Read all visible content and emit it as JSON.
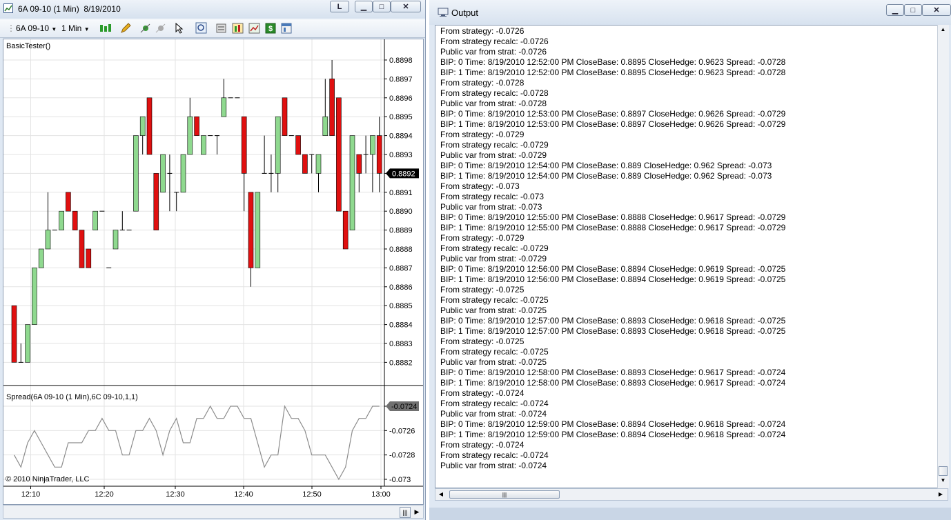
{
  "chart_window": {
    "title": "6A 09-10 (1 Min)  8/19/2010",
    "btn_l": "L",
    "toolbar": {
      "instrument": "6A 09-10",
      "interval": "1 Min"
    },
    "strategy_label": "BasicTester()",
    "indicator_label": "Spread(6A 09-10 (1 Min),6C 09-10,1,1)",
    "copyright": "© 2010 NinjaTrader, LLC",
    "price_current": "0.8892",
    "spread_current": "-0.0724"
  },
  "chart_data": [
    {
      "type": "candlestick",
      "title": "6A 09-10 (1 Min)",
      "ylim": [
        0.8881,
        0.8899
      ],
      "y_ticks": [
        "0.8898",
        "0.8897",
        "0.8896",
        "0.8895",
        "0.8894",
        "0.8893",
        "0.8892",
        "0.8891",
        "0.8890",
        "0.8889",
        "0.8888",
        "0.8887",
        "0.8886",
        "0.8885",
        "0.8884",
        "0.8883",
        "0.8882"
      ],
      "x_ticks": [
        "12:10",
        "12:20",
        "12:30",
        "12:40",
        "12:50",
        "13:00"
      ],
      "bars": [
        {
          "o": 0.8885,
          "h": 0.8885,
          "l": 0.8882,
          "c": 0.8882
        },
        {
          "o": 0.8882,
          "h": 0.8883,
          "l": 0.8882,
          "c": 0.8882
        },
        {
          "o": 0.8882,
          "h": 0.8884,
          "l": 0.8882,
          "c": 0.8884
        },
        {
          "o": 0.8884,
          "h": 0.8887,
          "l": 0.8884,
          "c": 0.8887
        },
        {
          "o": 0.8887,
          "h": 0.8888,
          "l": 0.8887,
          "c": 0.8888
        },
        {
          "o": 0.8888,
          "h": 0.8891,
          "l": 0.8888,
          "c": 0.8889
        },
        {
          "o": 0.8889,
          "h": 0.8889,
          "l": 0.8889,
          "c": 0.8889
        },
        {
          "o": 0.8889,
          "h": 0.889,
          "l": 0.8889,
          "c": 0.889
        },
        {
          "o": 0.8891,
          "h": 0.8891,
          "l": 0.889,
          "c": 0.889
        },
        {
          "o": 0.889,
          "h": 0.889,
          "l": 0.8889,
          "c": 0.8889
        },
        {
          "o": 0.8889,
          "h": 0.8889,
          "l": 0.8887,
          "c": 0.8887
        },
        {
          "o": 0.8888,
          "h": 0.8888,
          "l": 0.8887,
          "c": 0.8887
        },
        {
          "o": 0.8889,
          "h": 0.889,
          "l": 0.8889,
          "c": 0.889
        },
        {
          "o": 0.889,
          "h": 0.889,
          "l": 0.889,
          "c": 0.889
        },
        {
          "o": 0.8887,
          "h": 0.8887,
          "l": 0.8887,
          "c": 0.8887
        },
        {
          "o": 0.8888,
          "h": 0.8889,
          "l": 0.8888,
          "c": 0.8889
        },
        {
          "o": 0.8889,
          "h": 0.889,
          "l": 0.8889,
          "c": 0.8889
        },
        {
          "o": 0.8889,
          "h": 0.8889,
          "l": 0.8889,
          "c": 0.8889
        },
        {
          "o": 0.889,
          "h": 0.8894,
          "l": 0.889,
          "c": 0.8894
        },
        {
          "o": 0.8894,
          "h": 0.8895,
          "l": 0.8893,
          "c": 0.8895
        },
        {
          "o": 0.8896,
          "h": 0.8896,
          "l": 0.8893,
          "c": 0.8893
        },
        {
          "o": 0.8892,
          "h": 0.8892,
          "l": 0.8889,
          "c": 0.8889
        },
        {
          "o": 0.8891,
          "h": 0.8893,
          "l": 0.8891,
          "c": 0.8893
        },
        {
          "o": 0.8892,
          "h": 0.8893,
          "l": 0.889,
          "c": 0.8892
        },
        {
          "o": 0.8891,
          "h": 0.8891,
          "l": 0.889,
          "c": 0.8891
        },
        {
          "o": 0.8891,
          "h": 0.8893,
          "l": 0.8891,
          "c": 0.8893
        },
        {
          "o": 0.8893,
          "h": 0.8896,
          "l": 0.8893,
          "c": 0.8895
        },
        {
          "o": 0.8895,
          "h": 0.8895,
          "l": 0.8894,
          "c": 0.8894
        },
        {
          "o": 0.8893,
          "h": 0.8894,
          "l": 0.8893,
          "c": 0.8894
        },
        {
          "o": 0.8894,
          "h": 0.8894,
          "l": 0.8894,
          "c": 0.8894
        },
        {
          "o": 0.8894,
          "h": 0.8894,
          "l": 0.8893,
          "c": 0.8894
        },
        {
          "o": 0.8895,
          "h": 0.8897,
          "l": 0.8895,
          "c": 0.8896
        },
        {
          "o": 0.8896,
          "h": 0.8896,
          "l": 0.8896,
          "c": 0.8896
        },
        {
          "o": 0.8896,
          "h": 0.8896,
          "l": 0.8896,
          "c": 0.8896
        },
        {
          "o": 0.8895,
          "h": 0.8895,
          "l": 0.889,
          "c": 0.8892
        },
        {
          "o": 0.8891,
          "h": 0.8891,
          "l": 0.8886,
          "c": 0.8887
        },
        {
          "o": 0.8887,
          "h": 0.8891,
          "l": 0.8887,
          "c": 0.8891
        },
        {
          "o": 0.8892,
          "h": 0.8894,
          "l": 0.8892,
          "c": 0.8892
        },
        {
          "o": 0.8892,
          "h": 0.8893,
          "l": 0.8891,
          "c": 0.8892
        },
        {
          "o": 0.8892,
          "h": 0.8895,
          "l": 0.8891,
          "c": 0.8895
        },
        {
          "o": 0.8896,
          "h": 0.8896,
          "l": 0.8894,
          "c": 0.8894
        },
        {
          "o": 0.8894,
          "h": 0.8894,
          "l": 0.8894,
          "c": 0.8894
        },
        {
          "o": 0.8894,
          "h": 0.8894,
          "l": 0.8893,
          "c": 0.8893
        },
        {
          "o": 0.8893,
          "h": 0.8893,
          "l": 0.8892,
          "c": 0.8892
        },
        {
          "o": 0.8893,
          "h": 0.8893,
          "l": 0.8892,
          "c": 0.8893
        },
        {
          "o": 0.8892,
          "h": 0.8893,
          "l": 0.8891,
          "c": 0.8893
        },
        {
          "o": 0.8894,
          "h": 0.8897,
          "l": 0.8894,
          "c": 0.8895
        },
        {
          "o": 0.8897,
          "h": 0.8898,
          "l": 0.8894,
          "c": 0.8894
        },
        {
          "o": 0.8896,
          "h": 0.8896,
          "l": 0.889,
          "c": 0.889
        },
        {
          "o": 0.889,
          "h": 0.889,
          "l": 0.8888,
          "c": 0.8888
        },
        {
          "o": 0.8889,
          "h": 0.8894,
          "l": 0.8889,
          "c": 0.8894
        },
        {
          "o": 0.8893,
          "h": 0.8893,
          "l": 0.8891,
          "c": 0.8892
        },
        {
          "o": 0.8893,
          "h": 0.8894,
          "l": 0.8892,
          "c": 0.8893
        },
        {
          "o": 0.8893,
          "h": 0.8894,
          "l": 0.8891,
          "c": 0.8894
        },
        {
          "o": 0.8894,
          "h": 0.8895,
          "l": 0.8891,
          "c": 0.8892
        }
      ]
    },
    {
      "type": "line",
      "title": "Spread(6A 09-10 (1 Min),6C 09-10,1,1)",
      "ylim": [
        -0.07305,
        -0.07235
      ],
      "y_ticks": [
        "-0.0724",
        "-0.0726",
        "-0.0728",
        "-0.073"
      ],
      "series": [
        {
          "values": [
            -0.0728,
            -0.0729,
            -0.0727,
            -0.0726,
            -0.0727,
            -0.0728,
            -0.0729,
            -0.0729,
            -0.0727,
            -0.0727,
            -0.0727,
            -0.0726,
            -0.0726,
            -0.0725,
            -0.0726,
            -0.0726,
            -0.0728,
            -0.0728,
            -0.0726,
            -0.0726,
            -0.0725,
            -0.0726,
            -0.0728,
            -0.0726,
            -0.0725,
            -0.0727,
            -0.0727,
            -0.0725,
            -0.0725,
            -0.0724,
            -0.0725,
            -0.0725,
            -0.0724,
            -0.0724,
            -0.0725,
            -0.0725,
            -0.0727,
            -0.0729,
            -0.0728,
            -0.0728,
            -0.0724,
            -0.0725,
            -0.0725,
            -0.0726,
            -0.0728,
            -0.0728,
            -0.0728,
            -0.0729,
            -0.073,
            -0.0729,
            -0.0726,
            -0.0725,
            -0.0725,
            -0.0724,
            -0.0724
          ]
        }
      ]
    }
  ],
  "output_window": {
    "title": "Output",
    "lines": [
      "From strategy: -0.0726",
      "From strategy recalc: -0.0726",
      "Public var from strat: -0.0726",
      "BIP: 0 Time: 8/19/2010 12:52:00 PM CloseBase: 0.8895 CloseHedge: 0.9623 Spread: -0.0728",
      "BIP: 1 Time: 8/19/2010 12:52:00 PM CloseBase: 0.8895 CloseHedge: 0.9623 Spread: -0.0728",
      "From strategy: -0.0728",
      "From strategy recalc: -0.0728",
      "Public var from strat: -0.0728",
      "BIP: 0 Time: 8/19/2010 12:53:00 PM CloseBase: 0.8897 CloseHedge: 0.9626 Spread: -0.0729",
      "BIP: 1 Time: 8/19/2010 12:53:00 PM CloseBase: 0.8897 CloseHedge: 0.9626 Spread: -0.0729",
      "From strategy: -0.0729",
      "From strategy recalc: -0.0729",
      "Public var from strat: -0.0729",
      "BIP: 0 Time: 8/19/2010 12:54:00 PM CloseBase: 0.889 CloseHedge: 0.962 Spread: -0.073",
      "BIP: 1 Time: 8/19/2010 12:54:00 PM CloseBase: 0.889 CloseHedge: 0.962 Spread: -0.073",
      "From strategy: -0.073",
      "From strategy recalc: -0.073",
      "Public var from strat: -0.073",
      "BIP: 0 Time: 8/19/2010 12:55:00 PM CloseBase: 0.8888 CloseHedge: 0.9617 Spread: -0.0729",
      "BIP: 1 Time: 8/19/2010 12:55:00 PM CloseBase: 0.8888 CloseHedge: 0.9617 Spread: -0.0729",
      "From strategy: -0.0729",
      "From strategy recalc: -0.0729",
      "Public var from strat: -0.0729",
      "BIP: 0 Time: 8/19/2010 12:56:00 PM CloseBase: 0.8894 CloseHedge: 0.9619 Spread: -0.0725",
      "BIP: 1 Time: 8/19/2010 12:56:00 PM CloseBase: 0.8894 CloseHedge: 0.9619 Spread: -0.0725",
      "From strategy: -0.0725",
      "From strategy recalc: -0.0725",
      "Public var from strat: -0.0725",
      "BIP: 0 Time: 8/19/2010 12:57:00 PM CloseBase: 0.8893 CloseHedge: 0.9618 Spread: -0.0725",
      "BIP: 1 Time: 8/19/2010 12:57:00 PM CloseBase: 0.8893 CloseHedge: 0.9618 Spread: -0.0725",
      "From strategy: -0.0725",
      "From strategy recalc: -0.0725",
      "Public var from strat: -0.0725",
      "BIP: 0 Time: 8/19/2010 12:58:00 PM CloseBase: 0.8893 CloseHedge: 0.9617 Spread: -0.0724",
      "BIP: 1 Time: 8/19/2010 12:58:00 PM CloseBase: 0.8893 CloseHedge: 0.9617 Spread: -0.0724",
      "From strategy: -0.0724",
      "From strategy recalc: -0.0724",
      "Public var from strat: -0.0724",
      "BIP: 0 Time: 8/19/2010 12:59:00 PM CloseBase: 0.8894 CloseHedge: 0.9618 Spread: -0.0724",
      "BIP: 1 Time: 8/19/2010 12:59:00 PM CloseBase: 0.8894 CloseHedge: 0.9618 Spread: -0.0724",
      "From strategy: -0.0724",
      "From strategy recalc: -0.0724",
      "Public var from strat: -0.0724"
    ]
  },
  "colors": {
    "up_candle": "#8fd98f",
    "down_candle": "#e01010",
    "spread_line": "#8c8c8c",
    "price_marker": "#000000",
    "spread_marker": "#707070"
  },
  "icons": [
    "chart-icon",
    "minimize-icon",
    "maximize-icon",
    "close-icon",
    "dropdown-icon",
    "candlestick-style-icon",
    "pencil-draw-icon",
    "crosshair-icon",
    "arrow-cursor-icon",
    "zoom-icon",
    "data-box-icon",
    "indicators-icon",
    "strategies-icon",
    "dollar-icon",
    "properties-icon",
    "output-window-icon",
    "resize-grip-icon"
  ]
}
